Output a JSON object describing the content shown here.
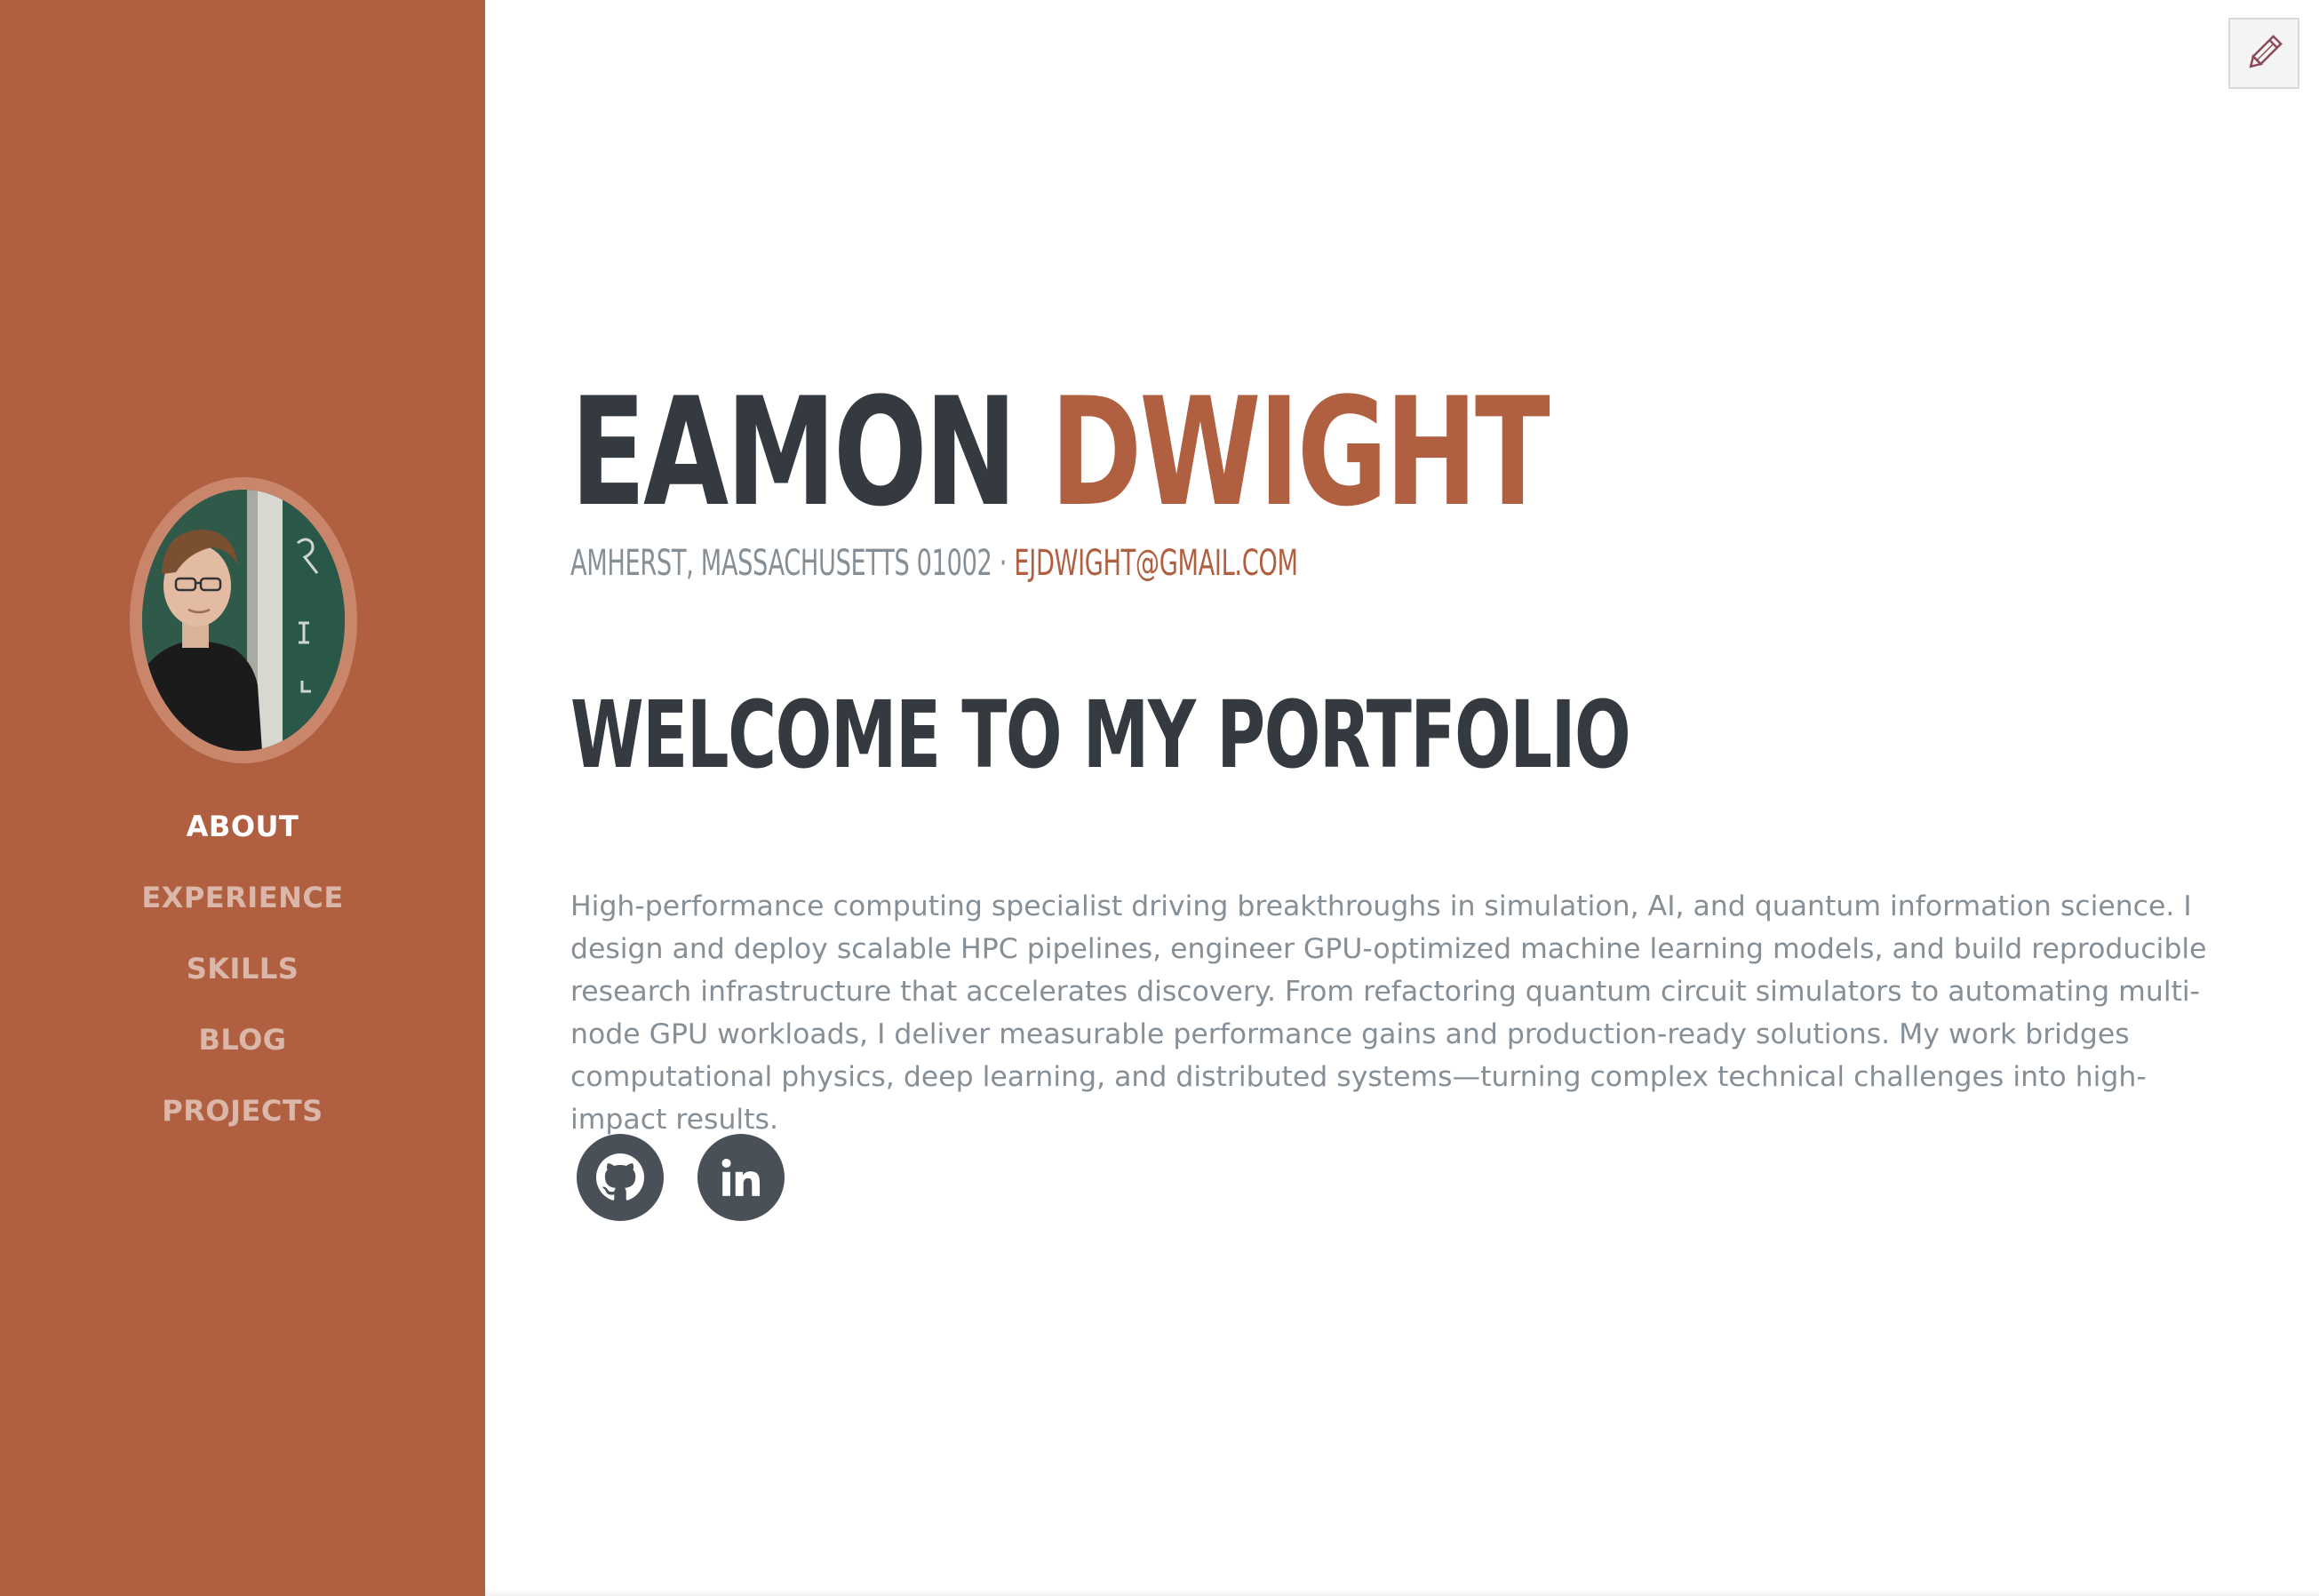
{
  "sidebar": {
    "avatar_alt": "Profile photo",
    "nav": [
      {
        "label": "ABOUT",
        "active": true
      },
      {
        "label": "EXPERIENCE",
        "active": false
      },
      {
        "label": "SKILLS",
        "active": false
      },
      {
        "label": "BLOG",
        "active": false
      },
      {
        "label": "PROJECTS",
        "active": false
      }
    ]
  },
  "header": {
    "first_name": "EAMON",
    "last_name": "DWIGHT",
    "location": "AMHERST, MASSACHUSETTS 01002 · ",
    "email": "EJDWIGHT@GMAIL.COM"
  },
  "main": {
    "heading": "WELCOME TO MY PORTFOLIO",
    "bio": "High-performance computing specialist driving breakthroughs in simulation, AI, and quantum information science. I design and deploy scalable HPC pipelines, engineer GPU-optimized machine learning models, and build reproducible research infrastructure that accelerates discovery. From refactoring quantum circuit simulators to automating multi-node GPU workloads, I deliver measurable performance gains and production-ready solutions. My work bridges computational physics, deep learning, and distributed systems—turning complex technical challenges into high-impact results."
  },
  "social": {
    "github_icon": "github-icon",
    "linkedin_icon": "linkedin-icon"
  },
  "colors": {
    "primary": "#b06040",
    "dark": "#343a40",
    "muted": "#868e96",
    "social_bg": "#495057"
  }
}
